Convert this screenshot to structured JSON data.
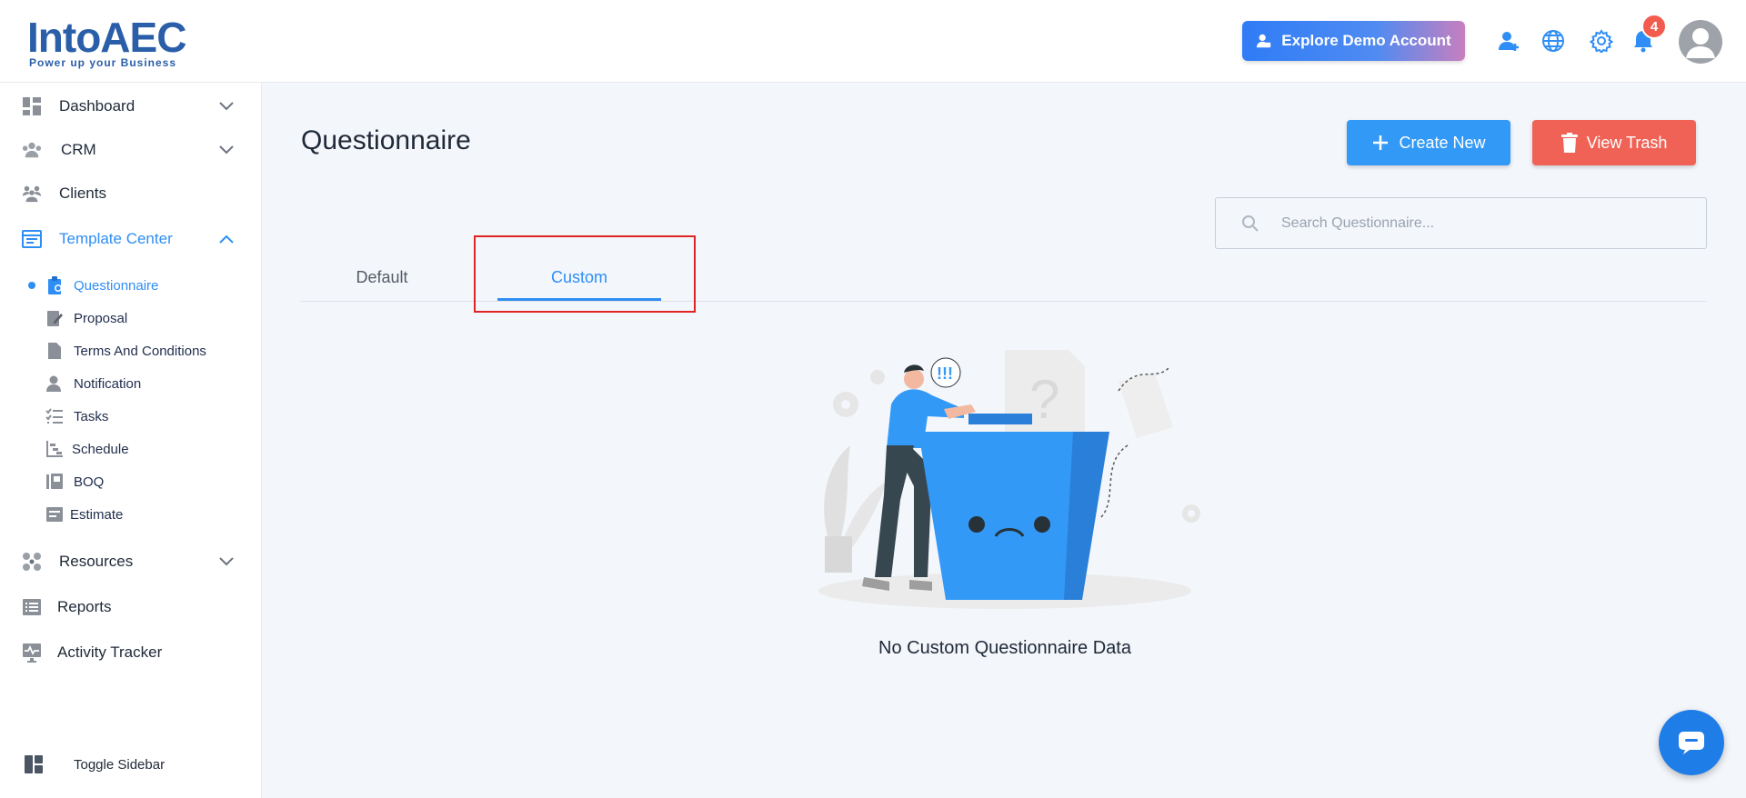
{
  "header": {
    "logo_main": "IntoAEC",
    "logo_tagline": "Power up your Business",
    "demo_button": "Explore Demo Account",
    "notification_count": "4",
    "icons": [
      "add-user-icon",
      "globe-icon",
      "gear-icon",
      "bell-icon",
      "avatar-icon"
    ]
  },
  "sidebar": {
    "items": [
      {
        "label": "Dashboard",
        "icon": "dashboard-icon"
      },
      {
        "label": "CRM",
        "icon": "crm-icon"
      },
      {
        "label": "Clients",
        "icon": "clients-icon"
      },
      {
        "label": "Template Center",
        "icon": "template-icon"
      },
      {
        "label": "Resources",
        "icon": "resources-icon"
      },
      {
        "label": "Reports",
        "icon": "reports-icon"
      },
      {
        "label": "Activity Tracker",
        "icon": "activity-icon"
      }
    ],
    "sub_items": [
      {
        "label": "Questionnaire",
        "icon": "questionnaire-icon"
      },
      {
        "label": "Proposal",
        "icon": "proposal-icon"
      },
      {
        "label": "Terms And Conditions",
        "icon": "document-icon"
      },
      {
        "label": "Notification",
        "icon": "notification-user-icon"
      },
      {
        "label": "Tasks",
        "icon": "tasks-icon"
      },
      {
        "label": "Schedule",
        "icon": "schedule-icon"
      },
      {
        "label": "BOQ",
        "icon": "boq-icon"
      },
      {
        "label": "Estimate",
        "icon": "estimate-icon"
      }
    ],
    "toggle_label": "Toggle Sidebar"
  },
  "main": {
    "title": "Questionnaire",
    "create_button": "Create New",
    "trash_button": "View Trash",
    "search_placeholder": "Search Questionnaire...",
    "tabs": [
      "Default",
      "Custom"
    ],
    "active_tab": "Custom",
    "empty_message": "No Custom Questionnaire Data"
  },
  "colors": {
    "accent": "#2f8ef5",
    "create": "#3399f7",
    "trash": "#f06255",
    "highlight": "#e02424"
  }
}
